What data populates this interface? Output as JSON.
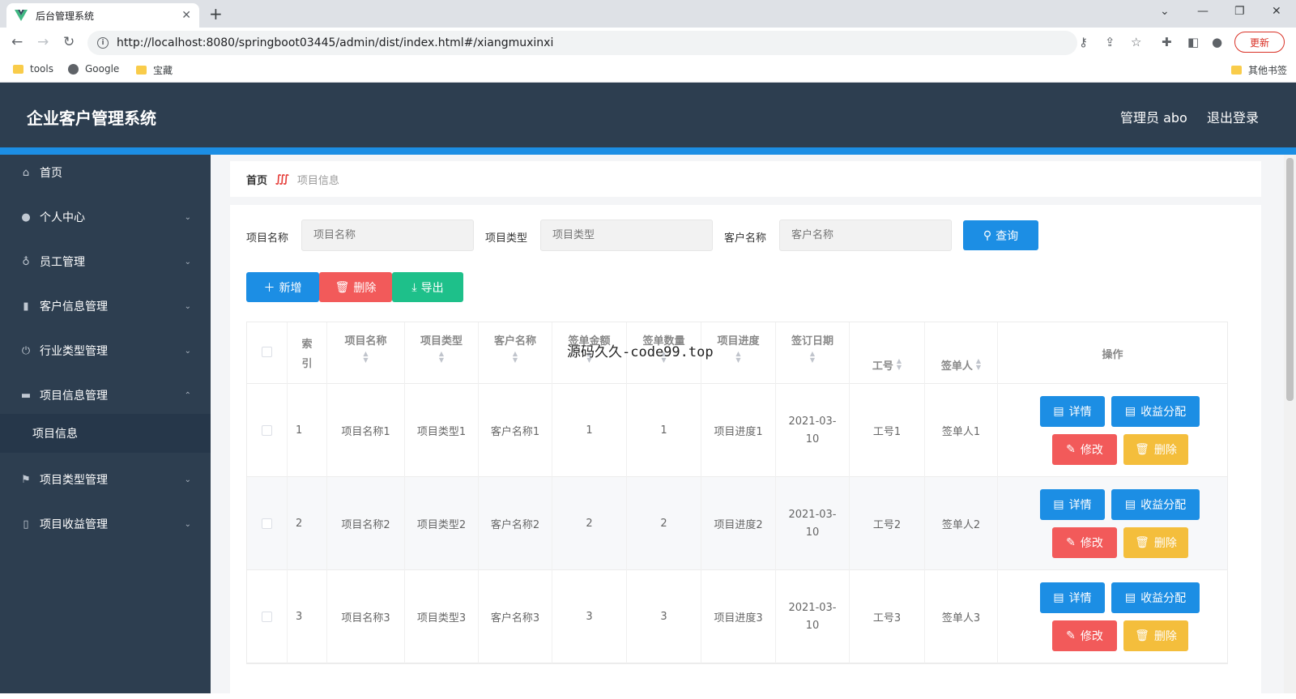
{
  "browser": {
    "tab_title": "后台管理系统",
    "url": "http://localhost:8080/springboot03445/admin/dist/index.html#/xiangmuxinxi",
    "update_label": "更新",
    "bookmarks": [
      "tools",
      "Google",
      "宝藏"
    ],
    "other_bookmarks": "其他书签"
  },
  "header": {
    "title": "企业客户管理系统",
    "user": "管理员 abo",
    "logout": "退出登录"
  },
  "sidebar": {
    "items": [
      {
        "label": "首页",
        "icon": "home-icon"
      },
      {
        "label": "个人中心",
        "icon": "user-icon"
      },
      {
        "label": "员工管理",
        "icon": "mic-icon"
      },
      {
        "label": "客户信息管理",
        "icon": "chart-icon"
      },
      {
        "label": "行业类型管理",
        "icon": "power-icon"
      },
      {
        "label": "项目信息管理",
        "icon": "briefcase-icon"
      },
      {
        "label": "项目类型管理",
        "icon": "flag-icon"
      },
      {
        "label": "项目收益管理",
        "icon": "phone-icon"
      }
    ],
    "subitem": "项目信息"
  },
  "breadcrumb": {
    "home": "首页",
    "current": "项目信息"
  },
  "search": {
    "fields": [
      {
        "label": "项目名称",
        "placeholder": "项目名称"
      },
      {
        "label": "项目类型",
        "placeholder": "项目类型"
      },
      {
        "label": "客户名称",
        "placeholder": "客户名称"
      }
    ],
    "query_label": "查询"
  },
  "actions": {
    "add": "新增",
    "delete": "删除",
    "export": "导出"
  },
  "table": {
    "headers": [
      "索引",
      "项目名称",
      "项目类型",
      "客户名称",
      "签单金额",
      "签单数量",
      "项目进度",
      "签订日期",
      "工号",
      "签单人",
      "操作"
    ],
    "rows": [
      {
        "idx": "1",
        "name": "项目名称1",
        "type": "项目类型1",
        "customer": "客户名称1",
        "amount": "1",
        "qty": "1",
        "progress": "项目进度1",
        "date": "2021-03-10",
        "job_no": "工号1",
        "signer": "签单人1"
      },
      {
        "idx": "2",
        "name": "项目名称2",
        "type": "项目类型2",
        "customer": "客户名称2",
        "amount": "2",
        "qty": "2",
        "progress": "项目进度2",
        "date": "2021-03-10",
        "job_no": "工号2",
        "signer": "签单人2"
      },
      {
        "idx": "3",
        "name": "项目名称3",
        "type": "项目类型3",
        "customer": "客户名称3",
        "amount": "3",
        "qty": "3",
        "progress": "项目进度3",
        "date": "2021-03-10",
        "job_no": "工号3",
        "signer": "签单人3"
      }
    ],
    "row_actions": {
      "detail": "详情",
      "profit": "收益分配",
      "edit": "修改",
      "delete": "删除"
    }
  },
  "watermark": "源码久久-code99.top"
}
